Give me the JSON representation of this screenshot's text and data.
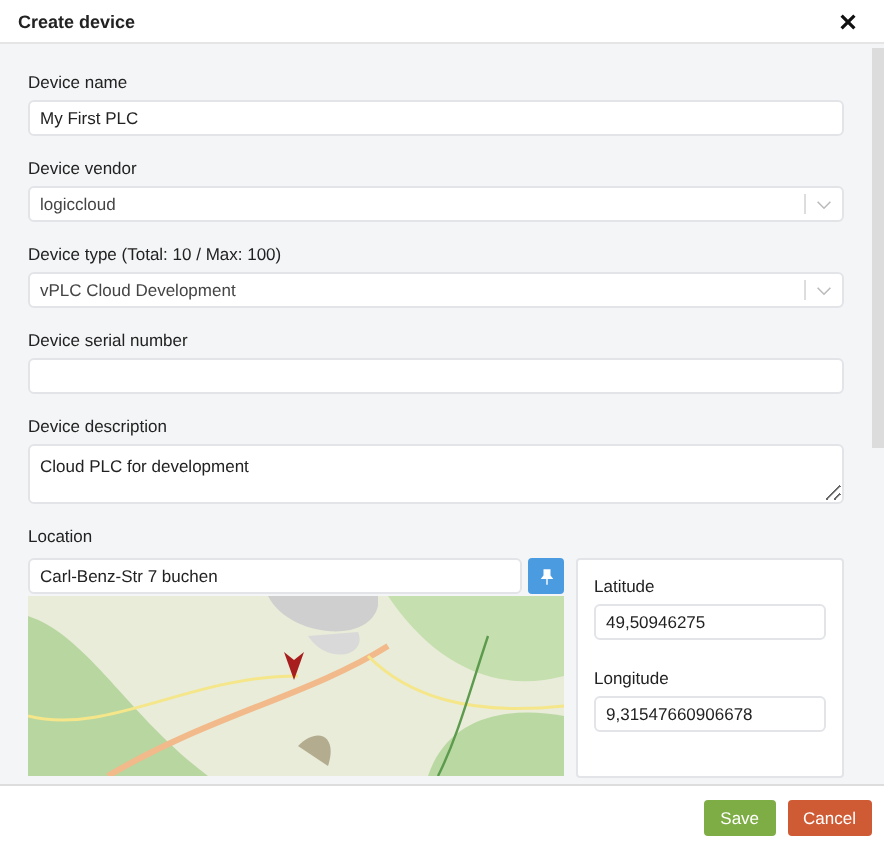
{
  "dialog": {
    "title": "Create device"
  },
  "fields": [
    {
      "kind": "text",
      "label": "Device name",
      "value": "My First PLC"
    },
    {
      "kind": "select",
      "label": "Device vendor",
      "value": "logiccloud"
    },
    {
      "kind": "select",
      "label": "Device type (Total: 10 / Max: 100)",
      "value": "vPLC Cloud Development"
    },
    {
      "kind": "text",
      "label": "Device serial number"
    },
    {
      "kind": "textarea",
      "label": "Device description",
      "value": "Cloud PLC for development"
    }
  ],
  "location": {
    "label": "Location",
    "address": "Carl-Benz-Str 7 buchen",
    "coords": [
      {
        "label": "Latitude",
        "value": "49,50946275"
      },
      {
        "label": "Longitude",
        "value": "9,31547660906678"
      }
    ]
  },
  "buttons": [
    {
      "kind": "primary",
      "label": "Save"
    },
    {
      "kind": "danger",
      "label": "Cancel"
    }
  ]
}
